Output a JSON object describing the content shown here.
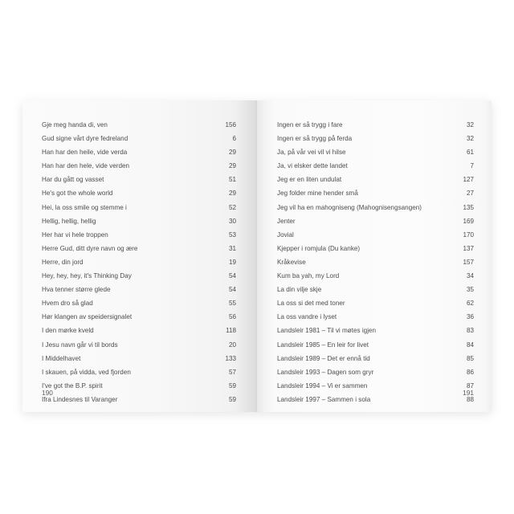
{
  "book": {
    "type": "open-book-spread",
    "content_kind": "alphabetical-song-index",
    "accent_color": "#4c4c4c",
    "page_color": "#fafafa"
  },
  "left_page": {
    "folio": "190",
    "entries": [
      {
        "title": "Gje meg handa di, ven",
        "page": "156"
      },
      {
        "title": "Gud signe vårt dyre fedreland",
        "page": "6"
      },
      {
        "title": "Han har den heile, vide verda",
        "page": "29"
      },
      {
        "title": "Han har den hele, vide verden",
        "page": "29"
      },
      {
        "title": "Har du gått og vasset",
        "page": "51"
      },
      {
        "title": "He's got the whole world",
        "page": "29"
      },
      {
        "title": "Hei, la oss smile og stemme i",
        "page": "52"
      },
      {
        "title": "Hellig, hellig, hellig",
        "page": "30"
      },
      {
        "title": "Her har vi hele troppen",
        "page": "53"
      },
      {
        "title": "Herre Gud, ditt dyre navn og ære",
        "page": "31"
      },
      {
        "title": "Herre, din jord",
        "page": "19"
      },
      {
        "title": "Hey, hey, hey, it's Thinking Day",
        "page": "54"
      },
      {
        "title": "Hva tenner større glede",
        "page": "54"
      },
      {
        "title": "Hvem dro så glad",
        "page": "55"
      },
      {
        "title": "Hør klangen av speidersignalet",
        "page": "56"
      },
      {
        "title": "I den mørke kveld",
        "page": "118"
      },
      {
        "title": "I Jesu navn går vi til bords",
        "page": "20"
      },
      {
        "title": "I Middelhavet",
        "page": "133"
      },
      {
        "title": "I skauen, på vidda, ved fjorden",
        "page": "57"
      },
      {
        "title": "I've got the B.P. spirit",
        "page": "59"
      },
      {
        "title": "Ifra Lindesnes til Varanger",
        "page": "59"
      }
    ]
  },
  "right_page": {
    "folio": "191",
    "entries": [
      {
        "title": "Ingen er så trygg i fare",
        "page": "32"
      },
      {
        "title": "Ingen er så trygg på ferda",
        "page": "32"
      },
      {
        "title": "Ja, på vår vei vil vi hilse",
        "page": "61"
      },
      {
        "title": "Ja, vi elsker dette landet",
        "page": "7"
      },
      {
        "title": "Jeg er en liten undulat",
        "page": "127"
      },
      {
        "title": "Jeg folder mine hender små",
        "page": "27"
      },
      {
        "title": "Jeg vil ha en mahogniseng (Mahognisengsangen)",
        "page": "135"
      },
      {
        "title": "Jenter",
        "page": "169"
      },
      {
        "title": "Jovial",
        "page": "170"
      },
      {
        "title": "Kjepper i romjula (Du kanke)",
        "page": "137"
      },
      {
        "title": "Kråkevise",
        "page": "157"
      },
      {
        "title": "Kum ba yah, my Lord",
        "page": "34"
      },
      {
        "title": "La din vilje skje",
        "page": "35"
      },
      {
        "title": "La oss si det med toner",
        "page": "62"
      },
      {
        "title": "La oss vandre i lyset",
        "page": "36"
      },
      {
        "title": "Landsleir 1981 – Til vi møtes igjen",
        "page": "83"
      },
      {
        "title": "Landsleir 1985 – En leir for livet",
        "page": "84"
      },
      {
        "title": "Landsleir 1989 – Det er ennå tid",
        "page": "85"
      },
      {
        "title": "Landsleir 1993 – Dagen som gryr",
        "page": "86"
      },
      {
        "title": "Landsleir 1994 – Vi er sammen",
        "page": "87"
      },
      {
        "title": "Landsleir 1997 – Sammen i sola",
        "page": "88"
      }
    ]
  }
}
